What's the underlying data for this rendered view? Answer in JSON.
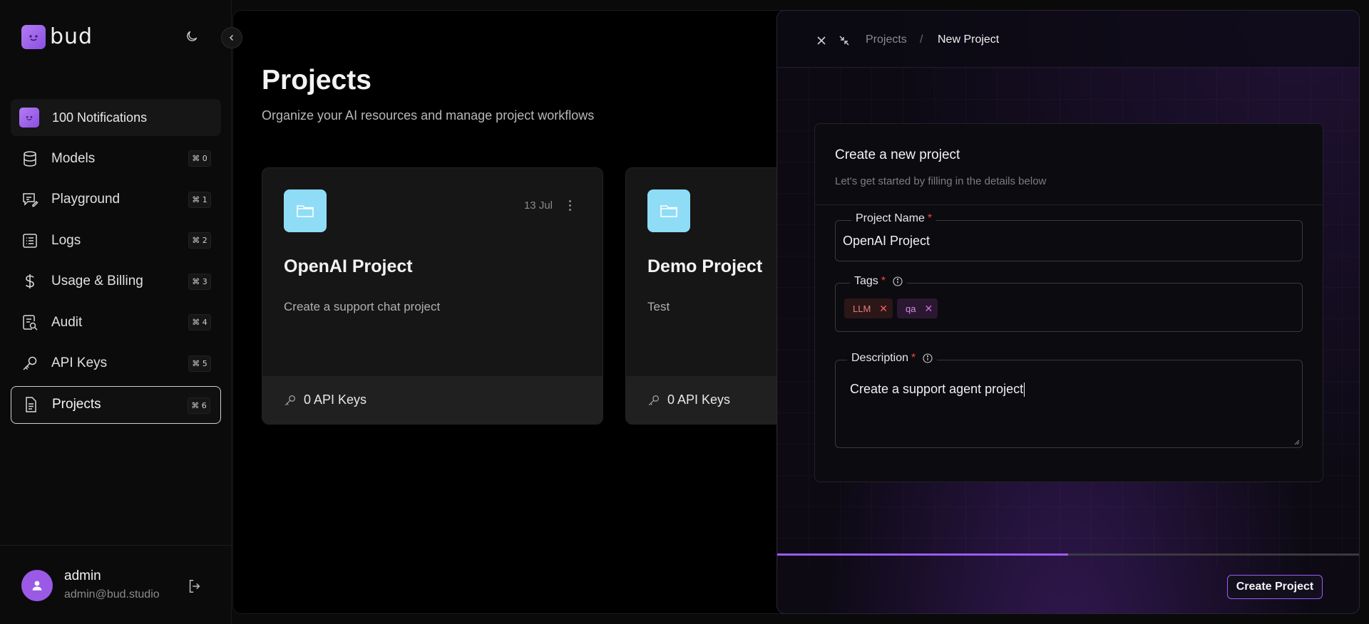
{
  "app": {
    "logo_text": "bud"
  },
  "sidebar": {
    "notifications_label": "100 Notifications",
    "items": [
      {
        "label": "Models",
        "shortcut": "⌘ 0",
        "icon": "database-icon"
      },
      {
        "label": "Playground",
        "shortcut": "⌘ 1",
        "icon": "chat-edit-icon"
      },
      {
        "label": "Logs",
        "shortcut": "⌘ 2",
        "icon": "list-icon"
      },
      {
        "label": "Usage & Billing",
        "shortcut": "⌘ 3",
        "icon": "dollar-icon"
      },
      {
        "label": "Audit",
        "shortcut": "⌘ 4",
        "icon": "audit-icon"
      },
      {
        "label": "API Keys",
        "shortcut": "⌘ 5",
        "icon": "key-icon"
      },
      {
        "label": "Projects",
        "shortcut": "⌘ 6",
        "icon": "document-icon",
        "active": true
      }
    ],
    "user": {
      "name": "admin",
      "email": "admin@bud.studio"
    }
  },
  "main": {
    "title": "Projects",
    "subtitle": "Organize your AI resources and manage project workflows",
    "projects": [
      {
        "title": "OpenAI Project",
        "description": "Create a support chat project",
        "date": "13 Jul",
        "api_keys": "0 API Keys"
      },
      {
        "title": "Demo Project",
        "description": "Test",
        "api_keys": "0 API Keys"
      }
    ]
  },
  "drawer": {
    "breadcrumb": [
      "Projects",
      "New Project"
    ],
    "breadcrumb_separator": "/",
    "form_title": "Create a new project",
    "form_subtitle": "Let's get started by filling in the details below",
    "project_name_label": "Project Name",
    "project_name_value": "OpenAI Project",
    "tags_label": "Tags",
    "tags": [
      {
        "label": "LLM",
        "color": "#e77d7d"
      },
      {
        "label": "qa",
        "color": "#d98be8"
      }
    ],
    "description_label": "Description",
    "description_value": "Create a support agent project",
    "required_mark": "*",
    "progress_percent": 50,
    "submit_label": "Create Project"
  },
  "colors": {
    "accent": "#9b5cf5",
    "brand": "#a66cf0",
    "folder": "#8fdcf7",
    "required": "#ec4646"
  }
}
